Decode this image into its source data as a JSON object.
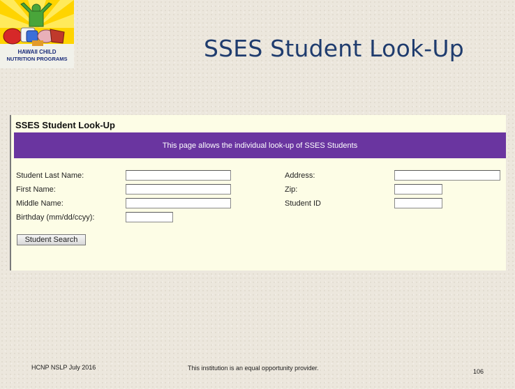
{
  "slide": {
    "title": "SSES Student Look-Up",
    "logo_text_line1": "HAWAII CHILD",
    "logo_text_line2": "NUTRITION PROGRAMS"
  },
  "panel": {
    "title": "SSES Student Look-Up",
    "banner": "This page allows the individual look-up of SSES Students",
    "banner_color": "#6a35a0",
    "background_color": "#fdfde6"
  },
  "form": {
    "left": [
      {
        "label": "Student Last Name:",
        "value": ""
      },
      {
        "label": "First Name:",
        "value": ""
      },
      {
        "label": "Middle Name:",
        "value": ""
      },
      {
        "label": "Birthday (mm/dd/ccyy):",
        "value": ""
      }
    ],
    "right": [
      {
        "label": "Address:",
        "value": ""
      },
      {
        "label": "Zip:",
        "value": ""
      },
      {
        "label": "Student ID",
        "value": ""
      }
    ],
    "search_button": "Student Search"
  },
  "footer": {
    "left": "HCNP NSLP July 2016",
    "center": "This institution is an equal opportunity provider.",
    "page_number": "106"
  }
}
